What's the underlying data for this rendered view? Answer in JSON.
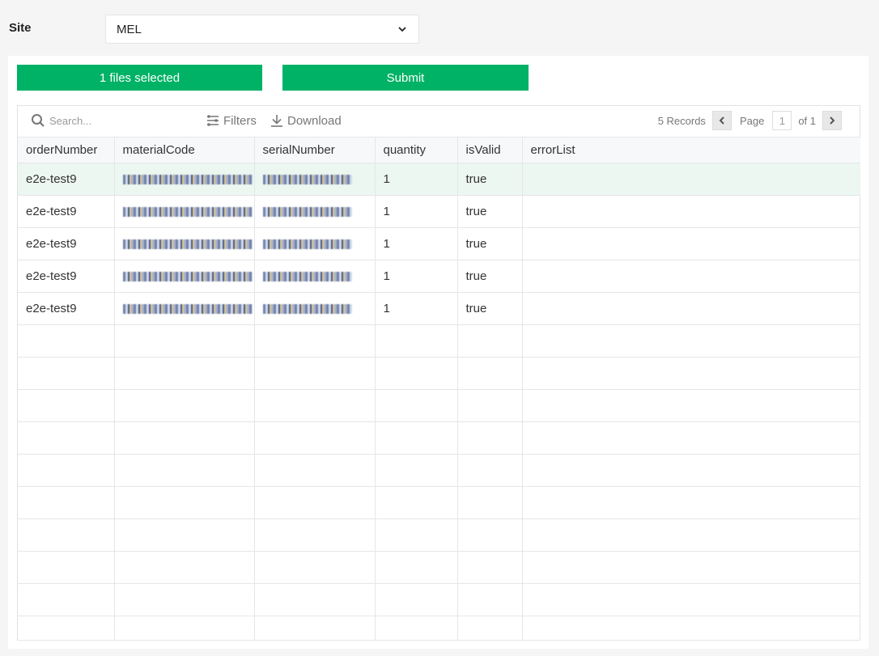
{
  "site": {
    "label": "Site",
    "selected": "MEL"
  },
  "actions": {
    "files_label": "1 files selected",
    "submit_label": "Submit"
  },
  "toolbar": {
    "search_placeholder": "Search...",
    "filters_label": "Filters",
    "download_label": "Download"
  },
  "pager": {
    "records": "5 Records",
    "page_label": "Page",
    "current_page": "1",
    "of_label": "of 1"
  },
  "colors": {
    "accent": "#00b265",
    "selected_row": "#ebf7f0"
  },
  "table": {
    "columns": [
      "orderNumber",
      "materialCode",
      "serialNumber",
      "quantity",
      "isValid",
      "errorList"
    ],
    "rows": [
      {
        "orderNumber": "e2e-test9",
        "materialCode": "[redacted]",
        "serialNumber": "[redacted]",
        "quantity": "1",
        "isValid": "true",
        "errorList": ""
      },
      {
        "orderNumber": "e2e-test9",
        "materialCode": "[redacted]",
        "serialNumber": "[redacted]",
        "quantity": "1",
        "isValid": "true",
        "errorList": ""
      },
      {
        "orderNumber": "e2e-test9",
        "materialCode": "[redacted]",
        "serialNumber": "[redacted]",
        "quantity": "1",
        "isValid": "true",
        "errorList": ""
      },
      {
        "orderNumber": "e2e-test9",
        "materialCode": "[redacted]",
        "serialNumber": "[redacted]",
        "quantity": "1",
        "isValid": "true",
        "errorList": ""
      },
      {
        "orderNumber": "e2e-test9",
        "materialCode": "[redacted]",
        "serialNumber": "[redacted]",
        "quantity": "1",
        "isValid": "true",
        "errorList": ""
      }
    ],
    "empty_rows": 10
  }
}
